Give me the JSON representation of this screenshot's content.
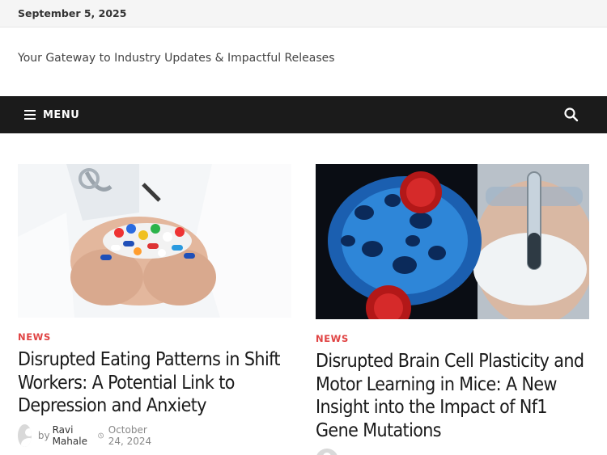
{
  "topbar": {
    "date": "September 5, 2025"
  },
  "site": {
    "tagline": "Your Gateway to Industry Updates & Impactful Releases"
  },
  "nav": {
    "menu_label": "MENU",
    "search_icon": "search-icon",
    "menu_icon": "hamburger-icon"
  },
  "colors": {
    "accent": "#e04343",
    "navbar": "#1b1b1b",
    "topbar": "#f5f5f5"
  },
  "posts": [
    {
      "category": "NEWS",
      "title": "Disrupted Eating Patterns in Shift Workers: A Potential Link to Depression and Anxiety",
      "by": "by",
      "author": "Ravi Mahale",
      "date": "October 24, 2024"
    },
    {
      "category": "NEWS",
      "title": "Disrupted Brain Cell Plasticity and Motor Learning in Mice: A New Insight into the Impact of Nf1 Gene Mutations"
    }
  ]
}
